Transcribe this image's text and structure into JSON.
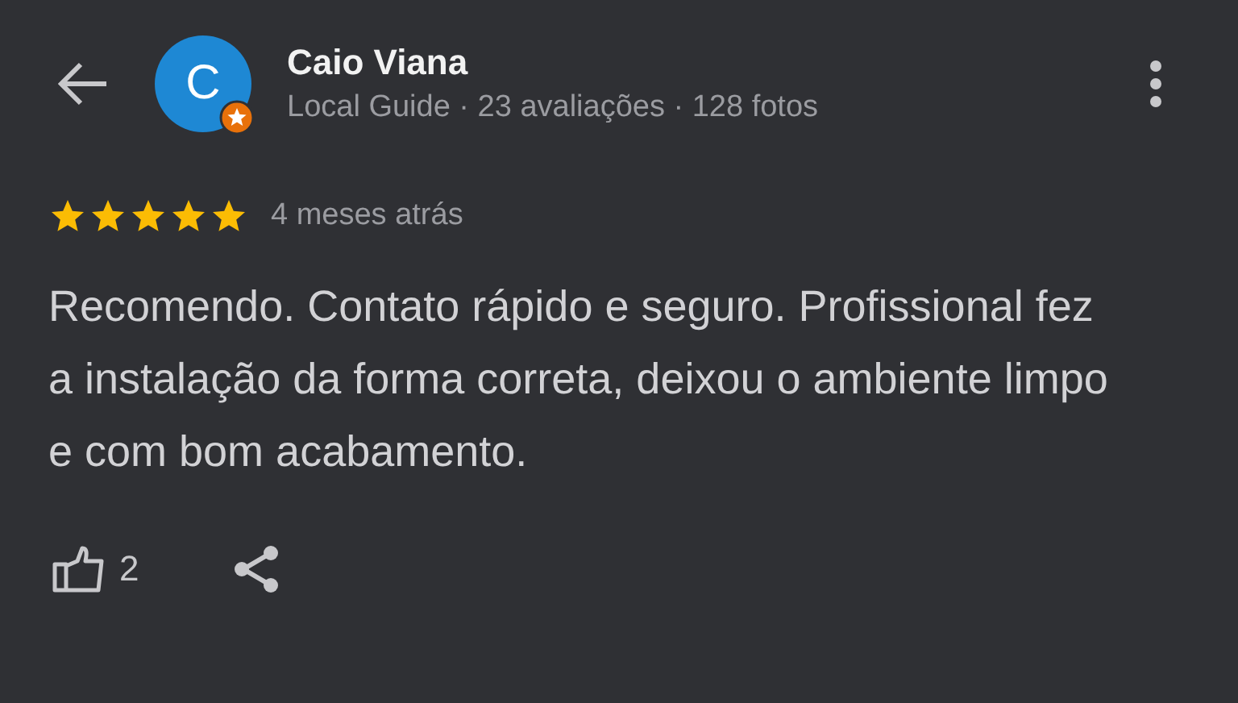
{
  "reviewer": {
    "initial": "C",
    "name": "Caio Viana",
    "meta": "Local Guide · 23 avaliações · 128 fotos",
    "local_guide": true
  },
  "review": {
    "stars": 5,
    "time": "4 meses atrás",
    "text": "Recomendo. Contato rápido e seguro. Profissional fez a instalação da forma correta, deixou o ambiente limpo e com bom acabamento."
  },
  "actions": {
    "likes": "2"
  }
}
